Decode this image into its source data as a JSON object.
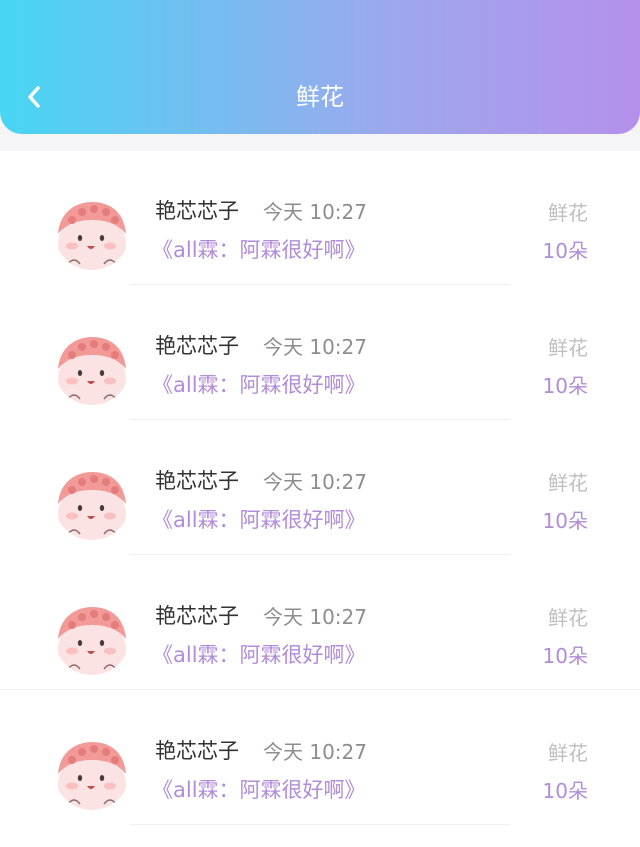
{
  "header": {
    "title": "鲜花",
    "back_icon": "chevron-left-icon"
  },
  "colors": {
    "header_gradient": [
      "#47d6f3",
      "#9ea7ed",
      "#b590eb"
    ],
    "accent": "#b08cd9"
  },
  "records": [
    {
      "name": "艳芯芯子",
      "time": "今天 10:27",
      "book": "《all霖：阿霖很好啊》",
      "gift": "鲜花",
      "count": "10朵"
    },
    {
      "name": "艳芯芯子",
      "time": "今天 10:27",
      "book": "《all霖：阿霖很好啊》",
      "gift": "鲜花",
      "count": "10朵"
    },
    {
      "name": "艳芯芯子",
      "time": "今天 10:27",
      "book": "《all霖：阿霖很好啊》",
      "gift": "鲜花",
      "count": "10朵"
    },
    {
      "name": "艳芯芯子",
      "time": "今天 10:27",
      "book": "《all霖：阿霖很好啊》",
      "gift": "鲜花",
      "count": "10朵"
    },
    {
      "name": "艳芯芯子",
      "time": "今天 10:27",
      "book": "《all霖：阿霖很好啊》",
      "gift": "鲜花",
      "count": "10朵"
    }
  ]
}
